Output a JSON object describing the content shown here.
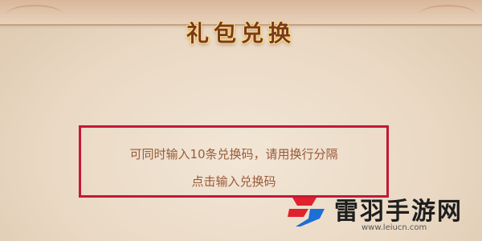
{
  "dialog": {
    "title": "礼包兑换",
    "input": {
      "hint_line1": "可同时输入10条兑换码，请用换行分隔",
      "hint_line2": "点击输入兑换码"
    }
  },
  "watermark": {
    "name": "雷羽手游网",
    "url": "www.leiucn.com"
  },
  "colors": {
    "highlight_border": "#c2183a",
    "hint_text": "#9a5a3a",
    "title_text": "#7a3a1c",
    "logo_red": "#e0222e",
    "logo_blue": "#1c6fd6"
  },
  "icons": {
    "watermark_logo": "leiyu-logo-icon"
  }
}
